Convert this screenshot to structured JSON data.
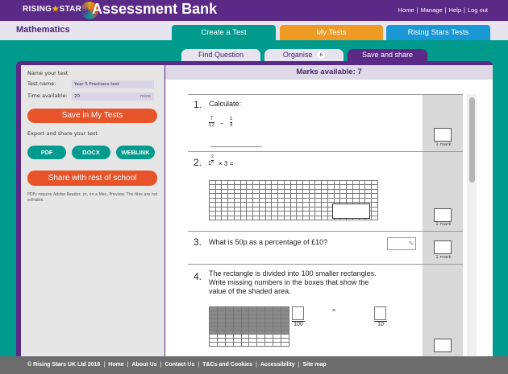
{
  "brand": {
    "rising": "RISING",
    "stars": "STARS",
    "assessment": "Assessment",
    "bank": "Bank"
  },
  "top_links": [
    "Home",
    "Manage",
    "Help",
    "Log out"
  ],
  "subject": "Mathematics",
  "main_tabs": {
    "create": "Create a Test",
    "my_tests": "My Tests",
    "rising_stars_tests": "Rising Stars Tests"
  },
  "sub_tabs": {
    "find": "Find Question",
    "organise": "Organise",
    "organise_count": "6",
    "save": "Save and share"
  },
  "sidebar": {
    "name_heading": "Name your test",
    "test_name_label": "Test name:",
    "test_name_value": "Year 5 Fractions test",
    "time_label": "Time available:",
    "time_value": "20",
    "time_units": "mins",
    "save_button": "Save in My Tests",
    "export_heading": "Export and share your test",
    "pdf_button": "PDF",
    "docx_button": "DOCX",
    "weblink_button": "WEBLINK",
    "share_button": "Share with rest of school",
    "note": "PDFs require Adobe Reader, or, on a Mac, Preview. The files are not editable."
  },
  "marks_available": "Marks available: 7",
  "questions": {
    "q1": {
      "num": "1.",
      "text": "Calculate:",
      "frac1_num": "7",
      "frac1_den": "12",
      "minus": "−",
      "frac2_num": "1",
      "frac2_den": "4",
      "mark": "1 mark"
    },
    "q2": {
      "num": "2.",
      "whole": "1",
      "frac_num": "2",
      "frac_den": "3",
      "rest": "× 3 =",
      "mark": "1 mark"
    },
    "q3": {
      "num": "3.",
      "text": "What is 50p as a percentage of £10?",
      "pct": "%",
      "mark": "1 mark"
    },
    "q4": {
      "num": "4.",
      "text1": "The rectangle is divided into 100 smaller rectangles.",
      "text2": "Write missing numbers in the boxes that show the",
      "text3": "value of the shaded area.",
      "den1": "100",
      "equals": "=",
      "den2": "10"
    }
  },
  "footer": [
    "© Rising Stars UK Ltd 2016",
    "Home",
    "About Us",
    "Contact Us",
    "T&Cs and Cookies",
    "Accessibility",
    "Site map"
  ],
  "colors": {
    "purple": "#5a2a86",
    "teal": "#009b8d",
    "orange": "#e8542a",
    "amber": "#ef9a25",
    "blue": "#1998d5"
  }
}
